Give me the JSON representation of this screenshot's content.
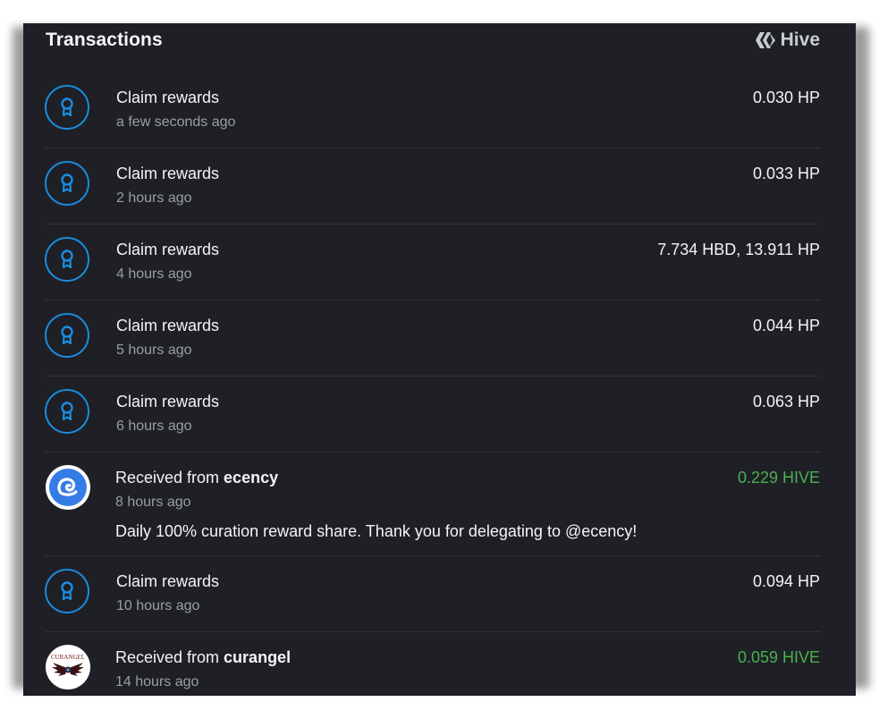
{
  "header": {
    "title": "Transactions",
    "brand": "Hive",
    "brand_icon": "hive-logo-icon"
  },
  "colors": {
    "panel_bg": "#1e2025",
    "accent_blue": "#1a8ce0",
    "incoming_green": "#4caf50",
    "muted_text": "#9a9ea6"
  },
  "transactions": [
    {
      "type": "claim",
      "icon": "award-ribbon-icon",
      "label": "Claim rewards",
      "time": "a few seconds ago",
      "amount": "0.030 HP"
    },
    {
      "type": "claim",
      "icon": "award-ribbon-icon",
      "label": "Claim rewards",
      "time": "2 hours ago",
      "amount": "0.033 HP"
    },
    {
      "type": "claim",
      "icon": "award-ribbon-icon",
      "label": "Claim rewards",
      "time": "4 hours ago",
      "amount": "7.734 HBD, 13.911 HP"
    },
    {
      "type": "claim",
      "icon": "award-ribbon-icon",
      "label": "Claim rewards",
      "time": "5 hours ago",
      "amount": "0.044 HP"
    },
    {
      "type": "claim",
      "icon": "award-ribbon-icon",
      "label": "Claim rewards",
      "time": "6 hours ago",
      "amount": "0.063 HP"
    },
    {
      "type": "transfer",
      "icon": "ecency-avatar",
      "label_prefix": "Received from ",
      "from": "ecency",
      "time": "8 hours ago",
      "amount": "0.229 HIVE",
      "memo": "Daily 100% curation reward share. Thank you for delegating to @ecency!"
    },
    {
      "type": "claim",
      "icon": "award-ribbon-icon",
      "label": "Claim rewards",
      "time": "10 hours ago",
      "amount": "0.094 HP"
    },
    {
      "type": "transfer",
      "icon": "curangel-avatar",
      "label_prefix": "Received from ",
      "from": "curangel",
      "avatar_text": "CURANGEL",
      "time": "14 hours ago",
      "amount": "0.059 HIVE"
    }
  ]
}
